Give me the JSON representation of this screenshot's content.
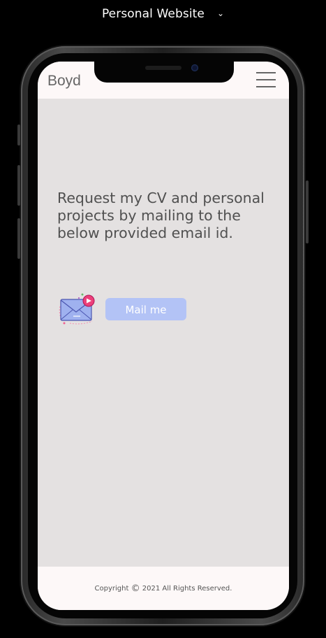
{
  "app_title": "Personal Website",
  "header": {
    "brand": "Boyd"
  },
  "main": {
    "description": "Request my CV and personal projects by mailing to the below provided email id.",
    "mail_button_label": "Mail me"
  },
  "footer": {
    "copyright_prefix": "Copyright",
    "copyright_symbol": "©",
    "copyright_rest": "2021  All Rights Reserved."
  },
  "colors": {
    "screen_bg": "#e4e1e1",
    "header_bg": "#fdf8f8",
    "button_bg": "#b3c3f6",
    "text": "#505050"
  },
  "icons": {
    "top_dropdown": "chevron-down-icon",
    "menu": "hamburger-menu-icon",
    "mail": "mail-envelope-icon"
  }
}
